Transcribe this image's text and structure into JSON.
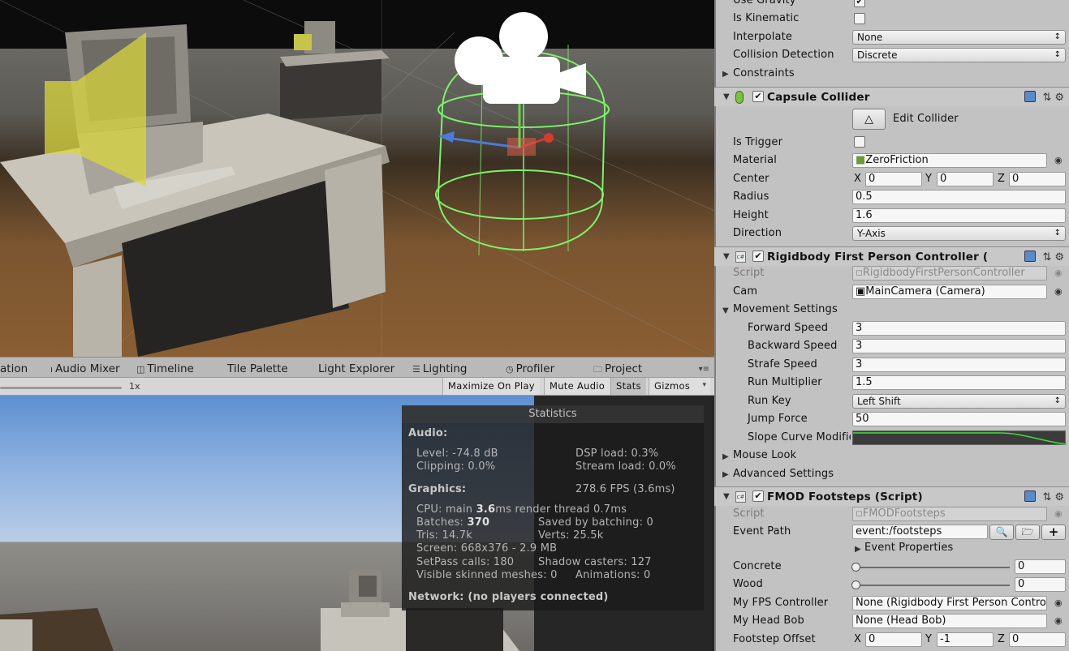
{
  "tabs": [
    {
      "label": "ation",
      "icon": ""
    },
    {
      "label": "Audio Mixer",
      "icon": "audio-mixer-icon"
    },
    {
      "label": "Timeline",
      "icon": "timeline-icon"
    },
    {
      "label": "Tile Palette",
      "icon": ""
    },
    {
      "label": "Light Explorer",
      "icon": ""
    },
    {
      "label": "Lighting",
      "icon": "lighting-icon"
    },
    {
      "label": "Profiler",
      "icon": "profiler-icon"
    },
    {
      "label": "Project",
      "icon": "folder-icon"
    }
  ],
  "game_toolbar": {
    "scale_value": "1x",
    "buttons": [
      "Maximize On Play",
      "Mute Audio",
      "Stats",
      "Gizmos"
    ]
  },
  "stats": {
    "title": "Statistics",
    "audio_header": "Audio:",
    "level": "Level: -74.8 dB",
    "clipping": "Clipping: 0.0%",
    "dsp_load": "DSP load: 0.3%",
    "stream_load": "Stream load: 0.0%",
    "graphics_header": "Graphics:",
    "fps": "278.6 FPS (3.6ms)",
    "cpu_prefix": "CPU: main ",
    "cpu_main": "3.6",
    "cpu_suffix": "ms  render thread 0.7ms",
    "batches_prefix": "Batches: ",
    "batches": "370",
    "saved_by_batching": "Saved by batching: 0",
    "tris": "Tris: 14.7k",
    "verts": "Verts: 25.5k",
    "screen": "Screen: 668x376 - 2.9 MB",
    "setpass": "SetPass calls: 180",
    "shadow_casters": "Shadow casters: 127",
    "skinned": "Visible skinned meshes: 0",
    "animations": "Animations: 0",
    "network": "Network: (no players connected)"
  },
  "inspector": {
    "rigidbody": {
      "use_gravity_label": "Use Gravity",
      "use_gravity": true,
      "is_kinematic_label": "Is Kinematic",
      "is_kinematic": false,
      "interpolate_label": "Interpolate",
      "interpolate": "None",
      "collision_label": "Collision Detection",
      "collision": "Discrete",
      "constraints_label": "Constraints"
    },
    "capsule": {
      "title": "Capsule Collider",
      "edit_collider": "Edit Collider",
      "is_trigger_label": "Is Trigger",
      "material_label": "Material",
      "material": "ZeroFriction",
      "center_label": "Center",
      "center": {
        "x": "0",
        "y": "0",
        "z": "0"
      },
      "radius_label": "Radius",
      "radius": "0.5",
      "height_label": "Height",
      "height": "1.6",
      "direction_label": "Direction",
      "direction": "Y-Axis"
    },
    "controller": {
      "title": "Rigidbody First Person Controller (",
      "script_label": "Script",
      "script": "RigidbodyFirstPersonController",
      "cam_label": "Cam",
      "cam": "MainCamera (Camera)",
      "movement_label": "Movement Settings",
      "forward_label": "Forward Speed",
      "forward": "3",
      "backward_label": "Backward Speed",
      "backward": "3",
      "strafe_label": "Strafe Speed",
      "strafe": "3",
      "run_mult_label": "Run Multiplier",
      "run_mult": "1.5",
      "run_key_label": "Run Key",
      "run_key": "Left Shift",
      "jump_label": "Jump Force",
      "jump": "50",
      "slope_label": "Slope Curve Modifier",
      "mouse_look_label": "Mouse Look",
      "advanced_label": "Advanced Settings"
    },
    "fmod": {
      "title": "FMOD Footsteps (Script)",
      "script_label": "Script",
      "script": "FMODFootsteps",
      "event_path_label": "Event Path",
      "event_path": "event:/footsteps",
      "event_props": "Event Properties",
      "concrete_label": "Concrete",
      "concrete": "0",
      "wood_label": "Wood",
      "wood": "0",
      "fps_ctrl_label": "My FPS Controller",
      "fps_ctrl": "None (Rigidbody First Person Controller)",
      "head_bob_label": "My Head Bob",
      "head_bob": "None (Head Bob)",
      "offset_label": "Footstep Offset",
      "offset": {
        "x": "0",
        "y": "-1",
        "z": "0"
      }
    }
  }
}
